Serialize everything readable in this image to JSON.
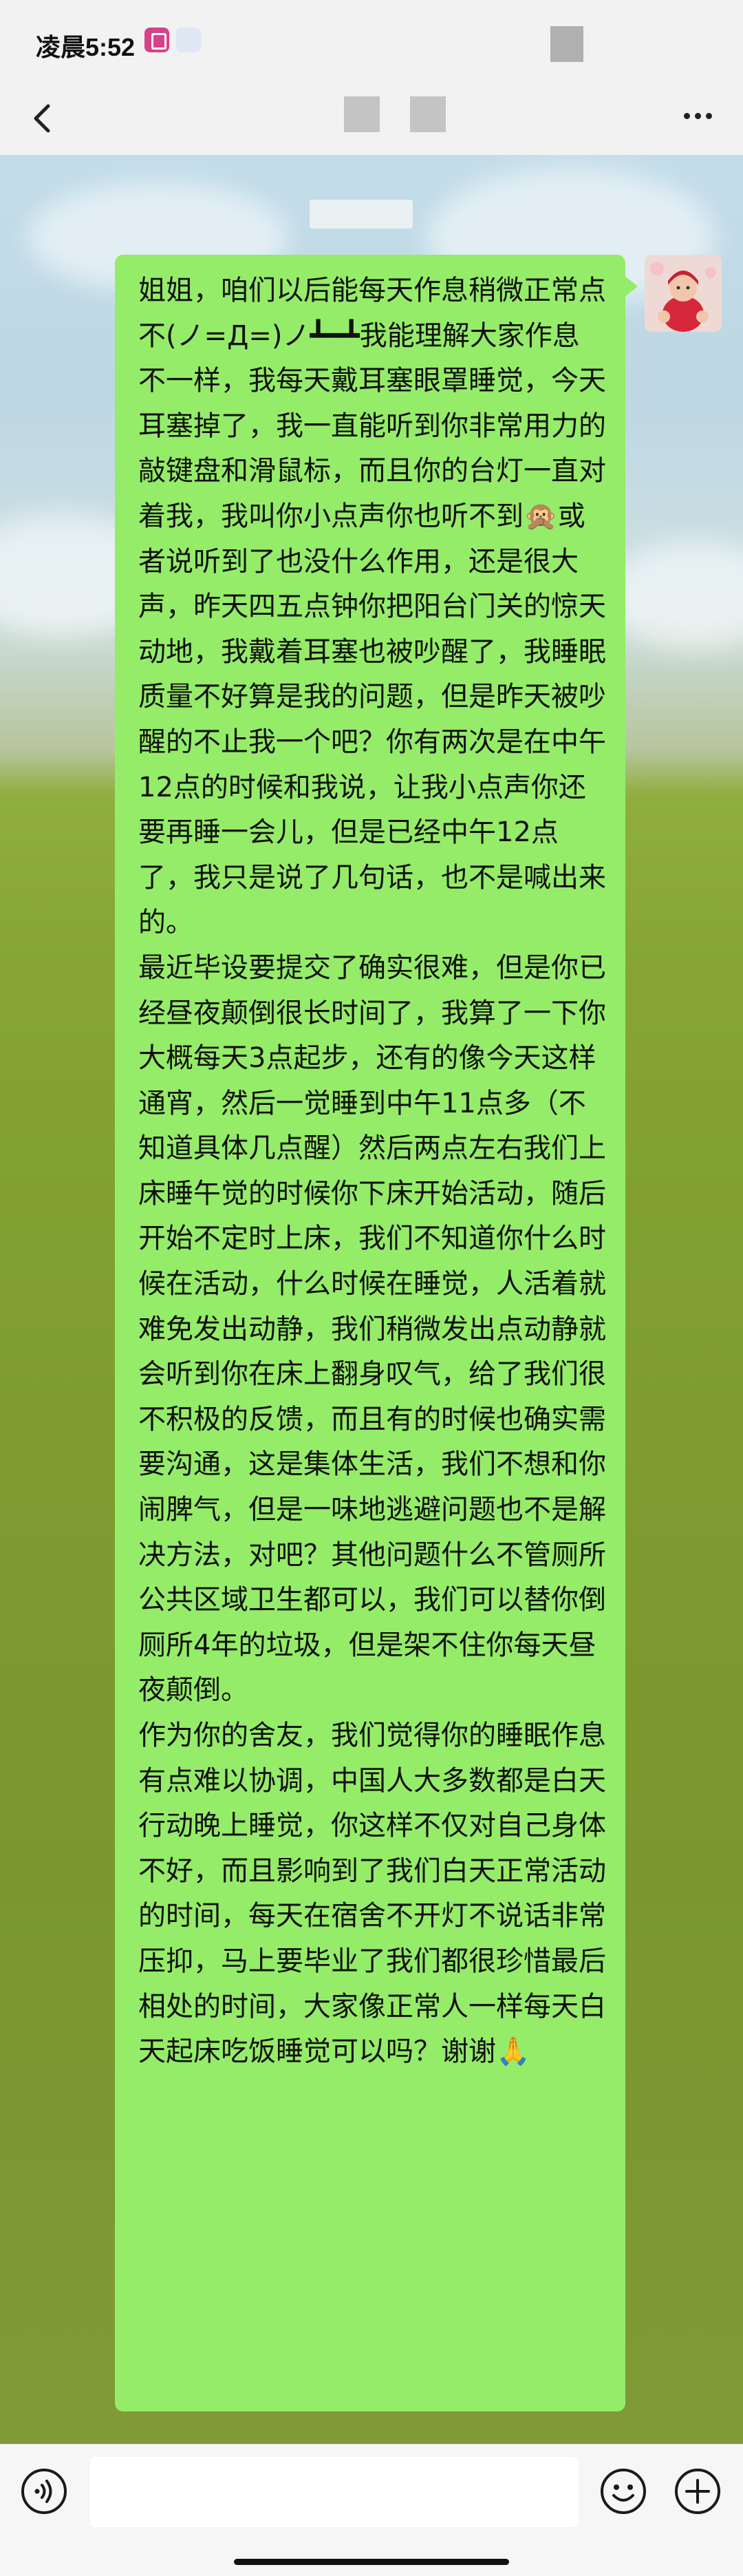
{
  "status_bar": {
    "time": "凌晨5:52"
  },
  "nav": {
    "back_icon": "chevron-left-icon",
    "more_icon": "more-dots-icon"
  },
  "chat": {
    "messages": [
      {
        "sender": "self",
        "text": "姐姐，咱们以后能每天作息稍微正常点不(ノ=Д=)ノ┻━┻我能理解大家作息不一样，我每天戴耳塞眼罩睡觉，今天耳塞掉了，我一直能听到你非常用力的敲键盘和滑鼠标，而且你的台灯一直对着我，我叫你小点声你也听不到🙊或者说听到了也没什么作用，还是很大声，昨天四五点钟你把阳台门关的惊天动地，我戴着耳塞也被吵醒了，我睡眠质量不好算是我的问题，但是昨天被吵醒的不止我一个吧？你有两次是在中午12点的时候和我说，让我小点声你还要再睡一会儿，但是已经中午12点了，我只是说了几句话，也不是喊出来的。\n最近毕设要提交了确实很难，但是你已经昼夜颠倒很长时间了，我算了一下你大概每天3点起步，还有的像今天这样通宵，然后一觉睡到中午11点多（不知道具体几点醒）然后两点左右我们上床睡午觉的时候你下床开始活动，随后开始不定时上床，我们不知道你什么时候在活动，什么时候在睡觉，人活着就难免发出动静，我们稍微发出点动静就会听到你在床上翻身叹气，给了我们很不积极的反馈，而且有的时候也确实需要沟通，这是集体生活，我们不想和你闹脾气，但是一味地逃避问题也不是解决方法，对吧？其他问题什么不管厕所公共区域卫生都可以，我们可以替你倒厕所4年的垃圾，但是架不住你每天昼夜颠倒。\n作为你的舍友，我们觉得你的睡眠作息有点难以协调，中国人大多数都是白天行动晚上睡觉，你这样不仅对自己身体不好，而且影响到了我们白天正常活动的时间，每天在宿舍不开灯不说话非常压抑，马上要毕业了我们都很珍惜最后相处的时间，大家像正常人一样每天白天起床吃饭睡觉可以吗？谢谢🙏"
      }
    ],
    "bubble_color": "#95ec69"
  },
  "input_bar": {
    "voice_icon": "voice-icon",
    "emoji_icon": "emoji-icon",
    "plus_icon": "plus-icon"
  }
}
